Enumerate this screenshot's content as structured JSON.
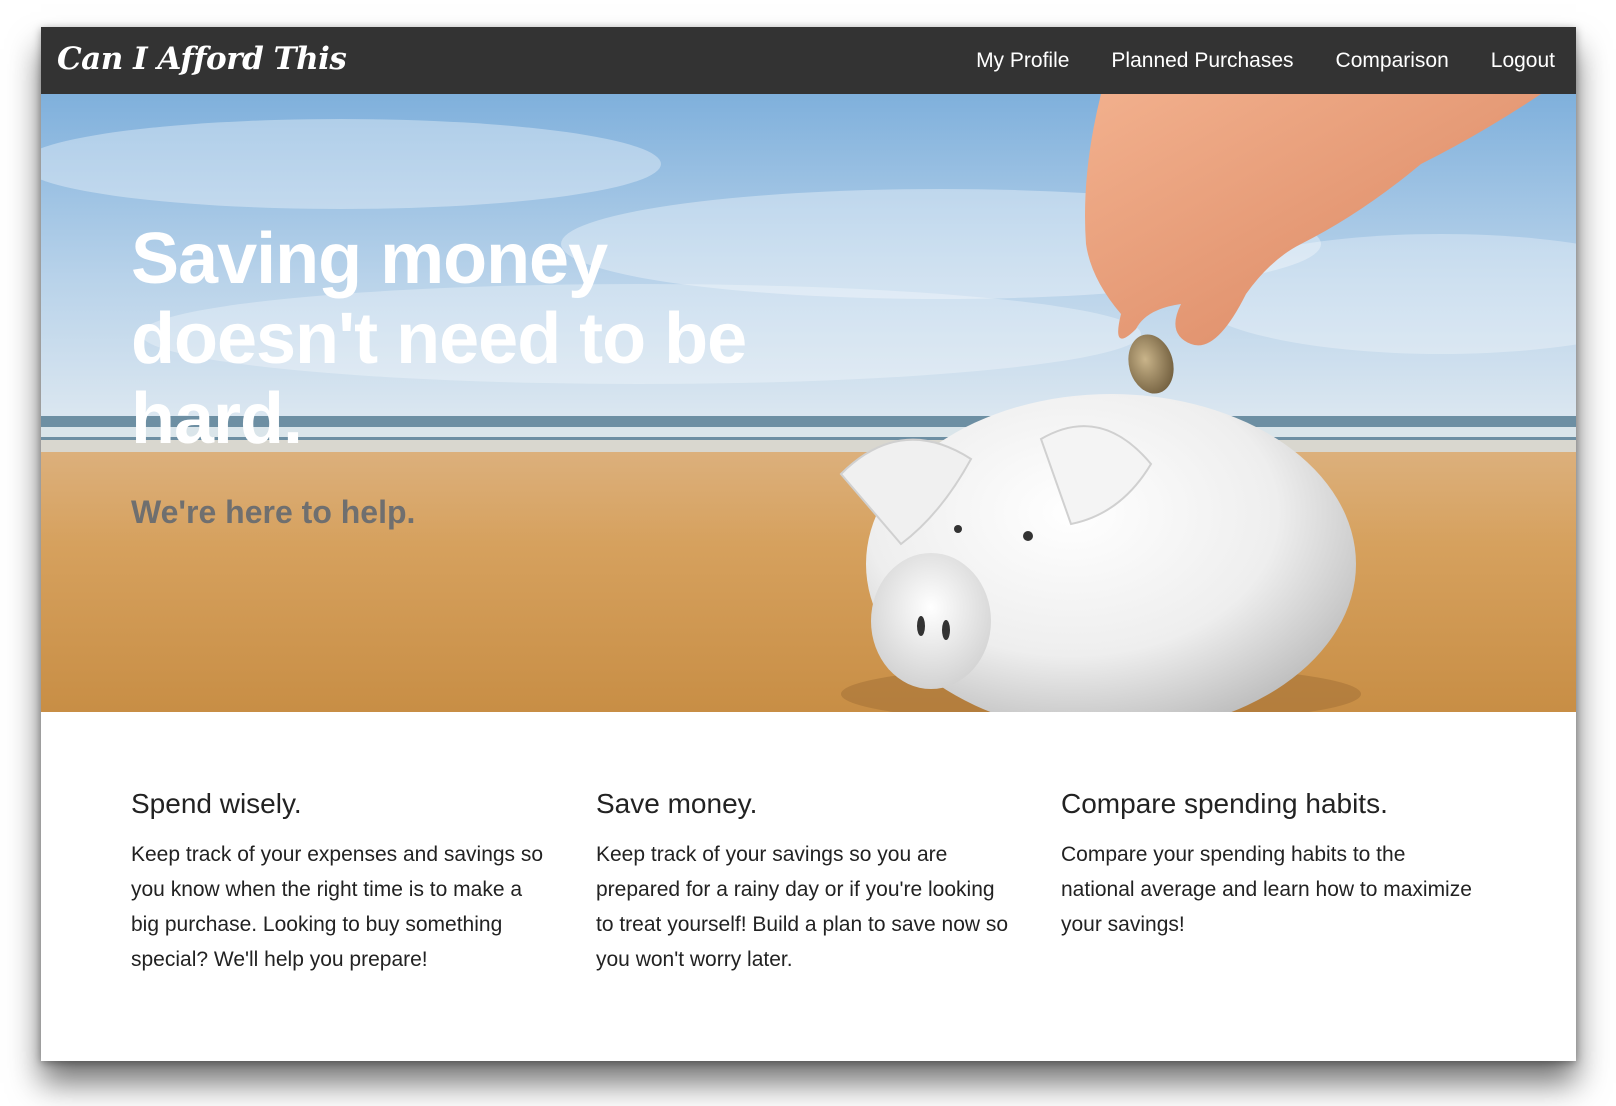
{
  "brand": {
    "name": "Can I Afford This"
  },
  "nav": {
    "items": [
      {
        "label": "My Profile"
      },
      {
        "label": "Planned Purchases"
      },
      {
        "label": "Comparison"
      },
      {
        "label": "Logout"
      }
    ]
  },
  "hero": {
    "title": "Saving money doesn't need to be hard.",
    "subtitle": "We're here to help."
  },
  "features": [
    {
      "heading": "Spend wisely.",
      "body": "Keep track of your expenses and savings so you know when the right time is to make a big purchase. Looking to buy something special? We'll help you prepare!"
    },
    {
      "heading": "Save money.",
      "body": "Keep track of your savings so you are prepared for a rainy day or if you're looking to treat yourself! Build a plan to save now so you won't worry later."
    },
    {
      "heading": "Compare spending habits.",
      "body": "Compare your spending habits to the national average and learn how to maximize your savings!"
    }
  ],
  "colors": {
    "navbar": "#333333",
    "nav_text": "#ffffff",
    "hero_title": "#ffffff",
    "hero_subtitle": "#6f6f6f",
    "body_text": "#222222"
  },
  "icons": {
    "hero_image": "piggy-bank-beach-photo"
  }
}
